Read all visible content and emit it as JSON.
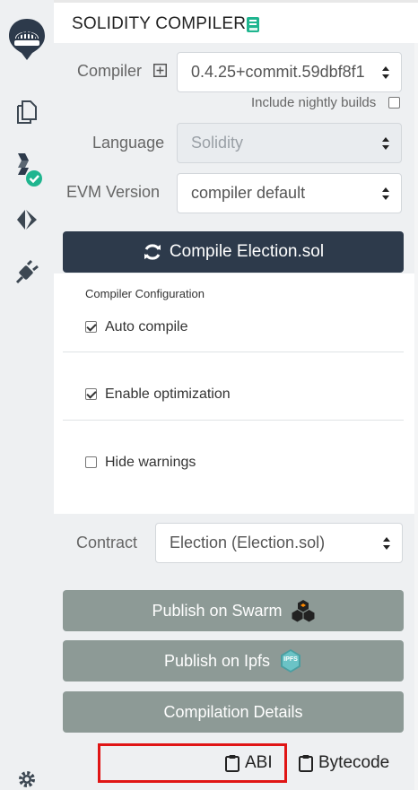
{
  "header": {
    "title": "SOLIDITY COMPILER",
    "doc_icon": "book-icon"
  },
  "sidebar": {
    "icons": [
      "remix-logo-icon",
      "file-explorer-icon",
      "solidity-compiler-icon",
      "deploy-run-icon",
      "plugin-manager-icon",
      "settings-icon"
    ]
  },
  "compiler": {
    "label": "Compiler",
    "add_icon": "plus-square-icon",
    "value": "0.4.25+commit.59dbf8f1",
    "nightly_label": "Include nightly builds",
    "nightly_checked": false
  },
  "language": {
    "label": "Language",
    "value": "Solidity"
  },
  "evm": {
    "label": "EVM Version",
    "value": "compiler default"
  },
  "compile_button": {
    "label": "Compile Election.sol",
    "icon": "refresh-icon"
  },
  "config": {
    "title": "Compiler Configuration",
    "auto_compile": {
      "label": "Auto compile",
      "checked": true
    },
    "optimization": {
      "label": "Enable optimization",
      "checked": true
    },
    "hide_warnings": {
      "label": "Hide warnings",
      "checked": false
    }
  },
  "contract": {
    "label": "Contract",
    "value": "Election (Election.sol)"
  },
  "actions": {
    "swarm": "Publish on Swarm",
    "ipfs": "Publish on Ipfs",
    "ipfs_badge": "IPFS",
    "details": "Compilation Details"
  },
  "copy": {
    "abi": "ABI",
    "bytecode": "Bytecode"
  },
  "colors": {
    "dark_button": "#2d3a4b",
    "grey_button": "#8d9a96",
    "accent_teal": "#1fb58f",
    "highlight_red": "#e01515"
  }
}
